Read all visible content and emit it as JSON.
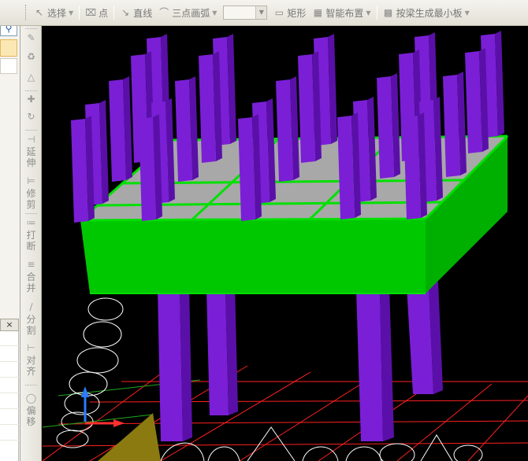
{
  "toolbar": {
    "select_label": "选择",
    "point_label": "点",
    "line_label": "直线",
    "arc_label": "三点画弧",
    "rect_label": "矩形",
    "smart_layout_label": "智能布置",
    "beam_slab_label": "按梁生成最小板"
  },
  "vtools": {
    "extend": "延伸",
    "trim": "修剪",
    "break": "打断",
    "merge": "合并",
    "split": "分割",
    "align": "对齐",
    "offset": "偏移"
  },
  "left_panel": {
    "close_glyph": "×"
  },
  "colors": {
    "column": "#7a1fd6",
    "slab_side": "#00c800",
    "slab_top": "#a8a8a8",
    "grid": "#ff2222",
    "axis_x": "#ff3030",
    "axis_y": "#2a7bff"
  }
}
